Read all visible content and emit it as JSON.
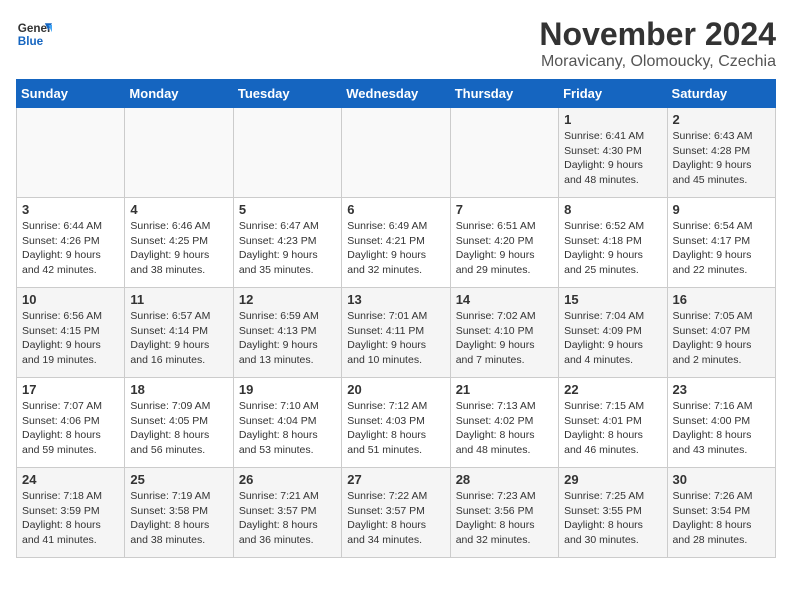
{
  "logo": {
    "general": "General",
    "blue": "Blue"
  },
  "title": "November 2024",
  "subtitle": "Moravicany, Olomoucky, Czechia",
  "headers": [
    "Sunday",
    "Monday",
    "Tuesday",
    "Wednesday",
    "Thursday",
    "Friday",
    "Saturday"
  ],
  "rows": [
    [
      {
        "day": "",
        "info": ""
      },
      {
        "day": "",
        "info": ""
      },
      {
        "day": "",
        "info": ""
      },
      {
        "day": "",
        "info": ""
      },
      {
        "day": "",
        "info": ""
      },
      {
        "day": "1",
        "info": "Sunrise: 6:41 AM\nSunset: 4:30 PM\nDaylight: 9 hours and 48 minutes."
      },
      {
        "day": "2",
        "info": "Sunrise: 6:43 AM\nSunset: 4:28 PM\nDaylight: 9 hours and 45 minutes."
      }
    ],
    [
      {
        "day": "3",
        "info": "Sunrise: 6:44 AM\nSunset: 4:26 PM\nDaylight: 9 hours and 42 minutes."
      },
      {
        "day": "4",
        "info": "Sunrise: 6:46 AM\nSunset: 4:25 PM\nDaylight: 9 hours and 38 minutes."
      },
      {
        "day": "5",
        "info": "Sunrise: 6:47 AM\nSunset: 4:23 PM\nDaylight: 9 hours and 35 minutes."
      },
      {
        "day": "6",
        "info": "Sunrise: 6:49 AM\nSunset: 4:21 PM\nDaylight: 9 hours and 32 minutes."
      },
      {
        "day": "7",
        "info": "Sunrise: 6:51 AM\nSunset: 4:20 PM\nDaylight: 9 hours and 29 minutes."
      },
      {
        "day": "8",
        "info": "Sunrise: 6:52 AM\nSunset: 4:18 PM\nDaylight: 9 hours and 25 minutes."
      },
      {
        "day": "9",
        "info": "Sunrise: 6:54 AM\nSunset: 4:17 PM\nDaylight: 9 hours and 22 minutes."
      }
    ],
    [
      {
        "day": "10",
        "info": "Sunrise: 6:56 AM\nSunset: 4:15 PM\nDaylight: 9 hours and 19 minutes."
      },
      {
        "day": "11",
        "info": "Sunrise: 6:57 AM\nSunset: 4:14 PM\nDaylight: 9 hours and 16 minutes."
      },
      {
        "day": "12",
        "info": "Sunrise: 6:59 AM\nSunset: 4:13 PM\nDaylight: 9 hours and 13 minutes."
      },
      {
        "day": "13",
        "info": "Sunrise: 7:01 AM\nSunset: 4:11 PM\nDaylight: 9 hours and 10 minutes."
      },
      {
        "day": "14",
        "info": "Sunrise: 7:02 AM\nSunset: 4:10 PM\nDaylight: 9 hours and 7 minutes."
      },
      {
        "day": "15",
        "info": "Sunrise: 7:04 AM\nSunset: 4:09 PM\nDaylight: 9 hours and 4 minutes."
      },
      {
        "day": "16",
        "info": "Sunrise: 7:05 AM\nSunset: 4:07 PM\nDaylight: 9 hours and 2 minutes."
      }
    ],
    [
      {
        "day": "17",
        "info": "Sunrise: 7:07 AM\nSunset: 4:06 PM\nDaylight: 8 hours and 59 minutes."
      },
      {
        "day": "18",
        "info": "Sunrise: 7:09 AM\nSunset: 4:05 PM\nDaylight: 8 hours and 56 minutes."
      },
      {
        "day": "19",
        "info": "Sunrise: 7:10 AM\nSunset: 4:04 PM\nDaylight: 8 hours and 53 minutes."
      },
      {
        "day": "20",
        "info": "Sunrise: 7:12 AM\nSunset: 4:03 PM\nDaylight: 8 hours and 51 minutes."
      },
      {
        "day": "21",
        "info": "Sunrise: 7:13 AM\nSunset: 4:02 PM\nDaylight: 8 hours and 48 minutes."
      },
      {
        "day": "22",
        "info": "Sunrise: 7:15 AM\nSunset: 4:01 PM\nDaylight: 8 hours and 46 minutes."
      },
      {
        "day": "23",
        "info": "Sunrise: 7:16 AM\nSunset: 4:00 PM\nDaylight: 8 hours and 43 minutes."
      }
    ],
    [
      {
        "day": "24",
        "info": "Sunrise: 7:18 AM\nSunset: 3:59 PM\nDaylight: 8 hours and 41 minutes."
      },
      {
        "day": "25",
        "info": "Sunrise: 7:19 AM\nSunset: 3:58 PM\nDaylight: 8 hours and 38 minutes."
      },
      {
        "day": "26",
        "info": "Sunrise: 7:21 AM\nSunset: 3:57 PM\nDaylight: 8 hours and 36 minutes."
      },
      {
        "day": "27",
        "info": "Sunrise: 7:22 AM\nSunset: 3:57 PM\nDaylight: 8 hours and 34 minutes."
      },
      {
        "day": "28",
        "info": "Sunrise: 7:23 AM\nSunset: 3:56 PM\nDaylight: 8 hours and 32 minutes."
      },
      {
        "day": "29",
        "info": "Sunrise: 7:25 AM\nSunset: 3:55 PM\nDaylight: 8 hours and 30 minutes."
      },
      {
        "day": "30",
        "info": "Sunrise: 7:26 AM\nSunset: 3:54 PM\nDaylight: 8 hours and 28 minutes."
      }
    ]
  ]
}
